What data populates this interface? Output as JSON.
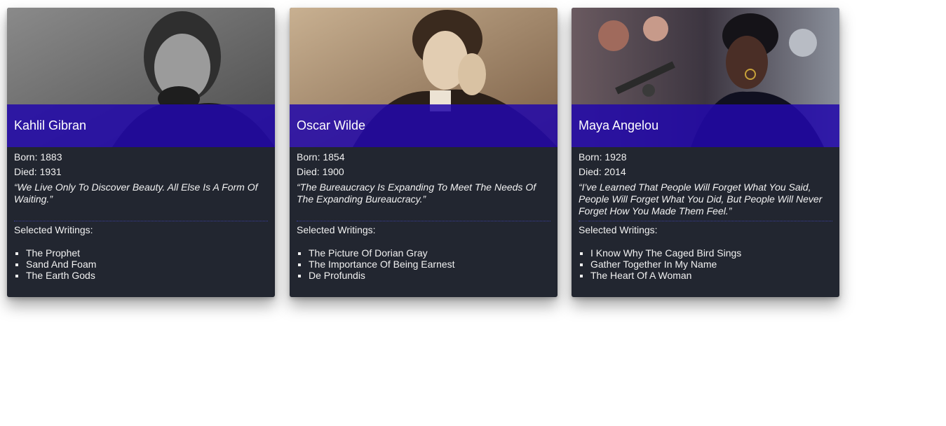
{
  "born_label": "Born:",
  "died_label": "Died:",
  "writings_label": "Selected Writings:",
  "accent_color": "#2208aa",
  "card_bg": "#222630",
  "cards": [
    {
      "name": "Kahlil Gibran",
      "born": "1883",
      "died": "1931",
      "quote": "“We Live Only To Discover Beauty. All Else Is A Form Of Waiting.”",
      "writings": [
        "The Prophet",
        "Sand And Foam",
        "The Earth Gods"
      ]
    },
    {
      "name": "Oscar Wilde",
      "born": "1854",
      "died": "1900",
      "quote": "“The Bureaucracy Is Expanding To Meet The Needs Of The Expanding Bureaucracy.”",
      "writings": [
        "The Picture Of Dorian Gray",
        "The Importance Of Being Earnest",
        "De Profundis"
      ]
    },
    {
      "name": "Maya Angelou",
      "born": "1928",
      "died": "2014",
      "quote": "“I've Learned That People Will Forget What You Said, People Will Forget What You Did, But People Will Never Forget How You Made Them Feel.”",
      "writings": [
        "I Know Why The Caged Bird Sings",
        "Gather Together In My Name",
        "The Heart Of A Woman"
      ]
    }
  ]
}
